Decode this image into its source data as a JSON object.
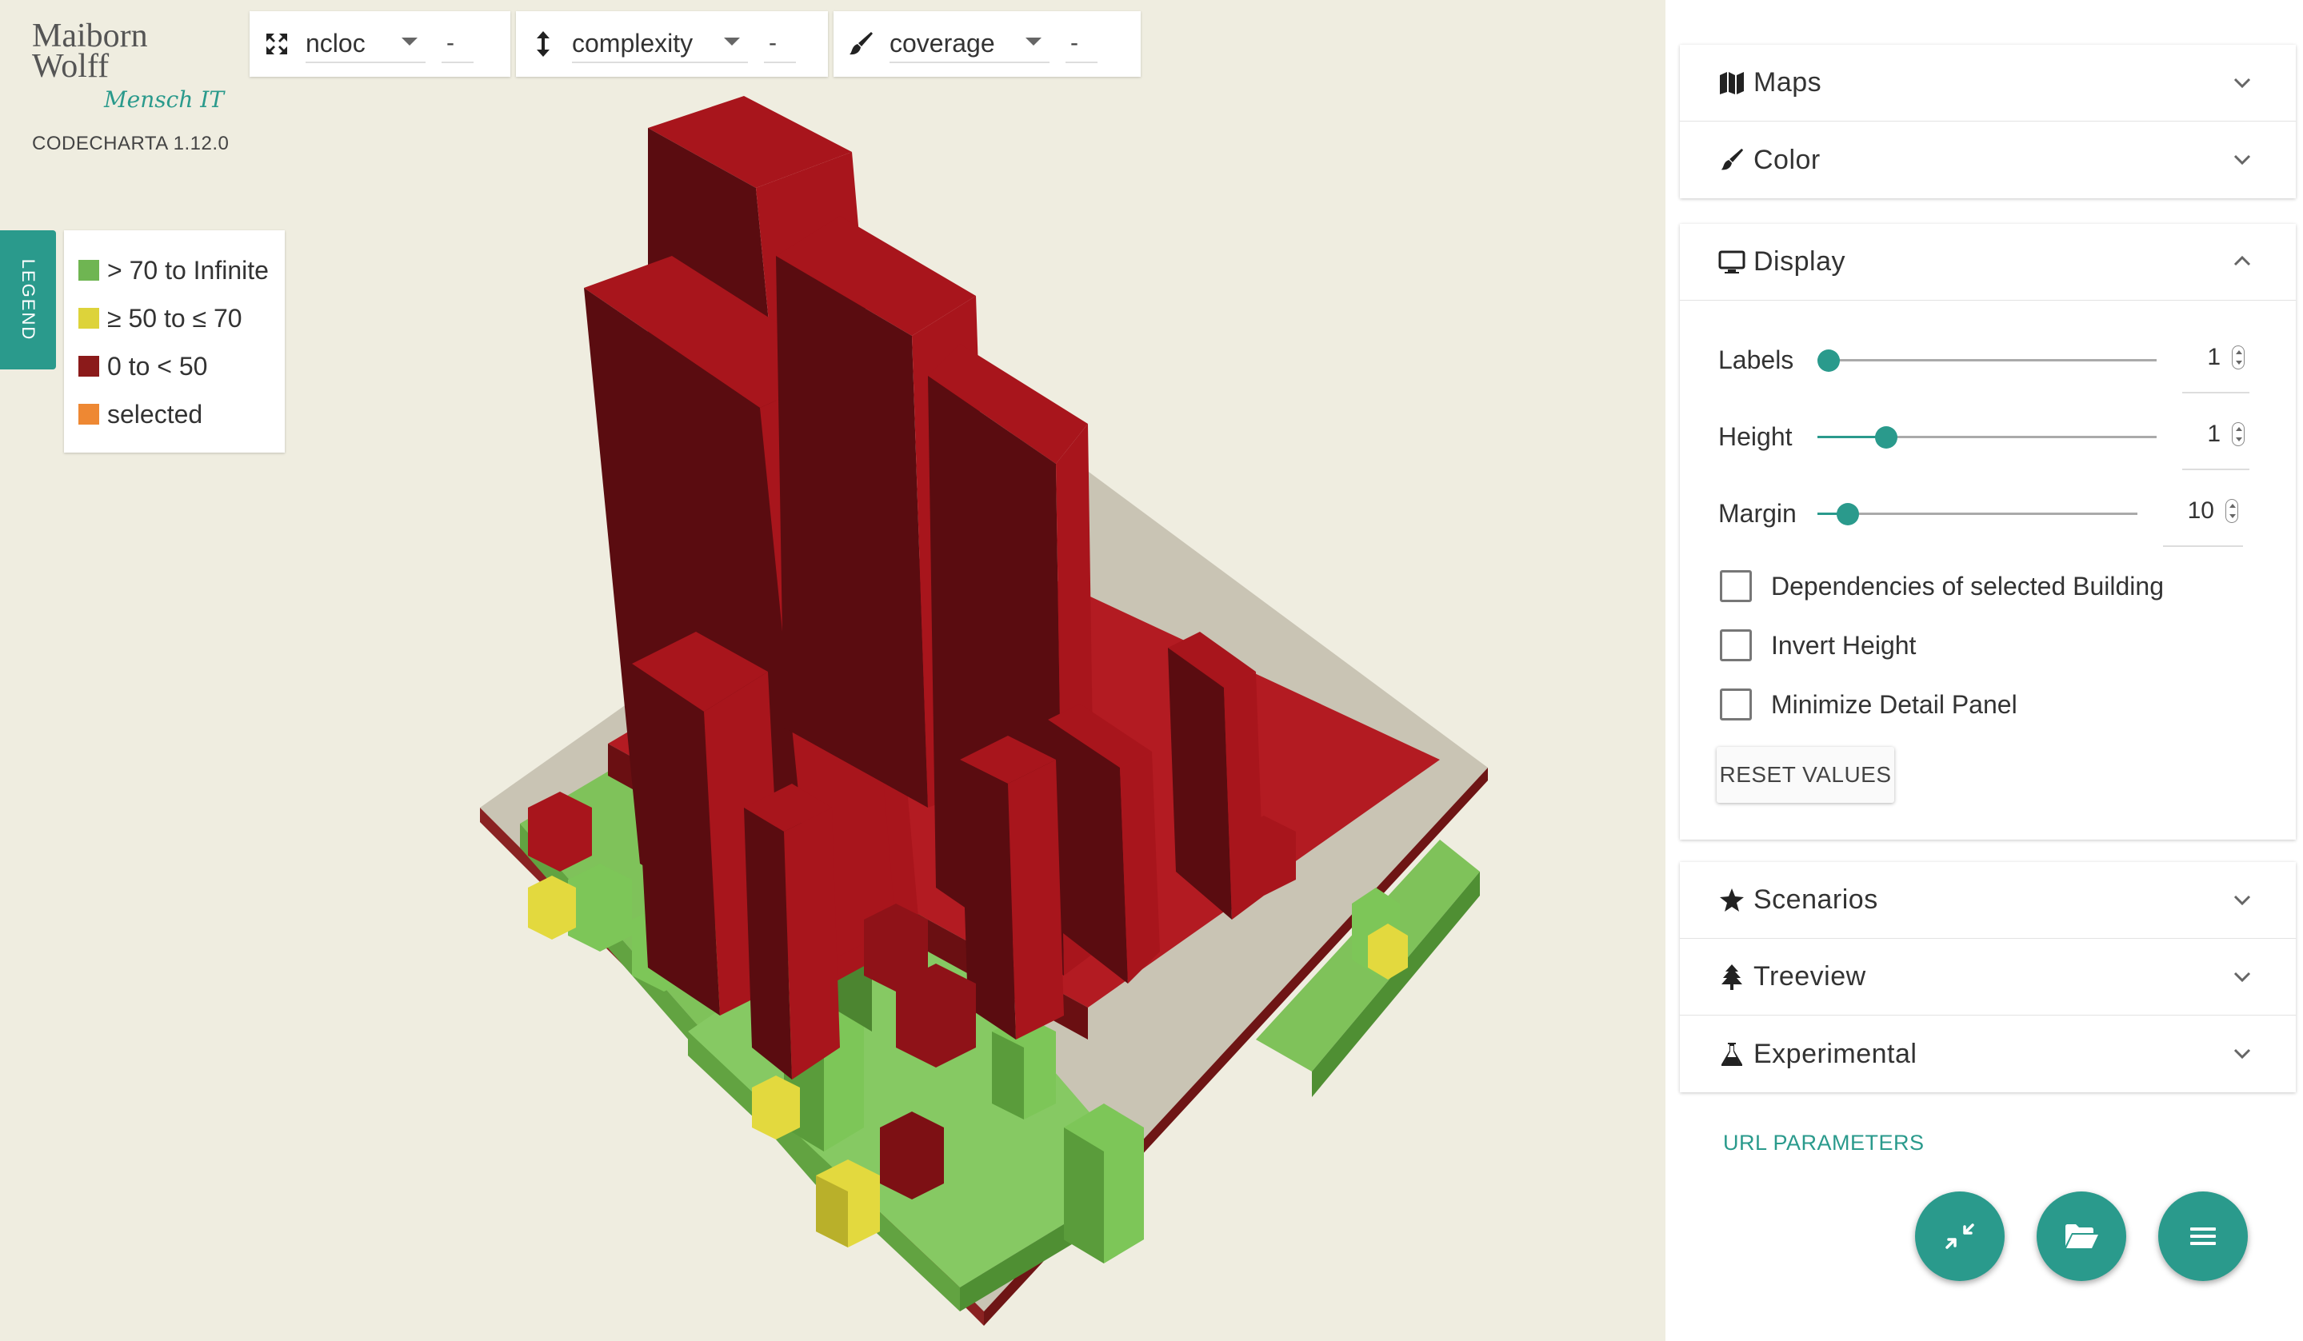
{
  "brand": {
    "line1": "Maiborn",
    "line2": "Wolff",
    "signature": "Mensch IT",
    "version": "CODECHARTA 1.12.0"
  },
  "metrics": [
    {
      "icon": "expand-arrows-icon",
      "value": "ncloc",
      "dash": "-"
    },
    {
      "icon": "vertical-arrow-icon",
      "value": "complexity",
      "dash": "-"
    },
    {
      "icon": "paint-brush-icon",
      "value": "coverage",
      "dash": "-"
    }
  ],
  "legend": {
    "tab_label": "LEGEND",
    "items": [
      {
        "label": "> 70 to Infinite",
        "color": "#6fb552"
      },
      {
        "label": "≥ 50 to ≤ 70",
        "color": "#ddd33a"
      },
      {
        "label": "0 to < 50",
        "color": "#8b1a1a"
      },
      {
        "label": "selected",
        "color": "#ee8833"
      }
    ]
  },
  "panel": {
    "maps": {
      "title": "Maps"
    },
    "color": {
      "title": "Color"
    },
    "display": {
      "title": "Display",
      "labels": {
        "label": "Labels",
        "value": "1"
      },
      "height": {
        "label": "Height",
        "value": "1"
      },
      "margin": {
        "label": "Margin",
        "value": "10"
      },
      "dependencies": "Dependencies of selected Building",
      "invert_height": "Invert Height",
      "minimize_detail": "Minimize Detail Panel",
      "reset": "RESET VALUES"
    },
    "scenarios": {
      "title": "Scenarios"
    },
    "treeview": {
      "title": "Treeview"
    },
    "experimental": {
      "title": "Experimental"
    },
    "url_parameters": "URL PARAMETERS"
  },
  "colors": {
    "accent": "#2a9a8c",
    "background": "#efede0",
    "building_red": "#a8151c",
    "building_green": "#6fb552",
    "building_yellow": "#ddd33a"
  }
}
